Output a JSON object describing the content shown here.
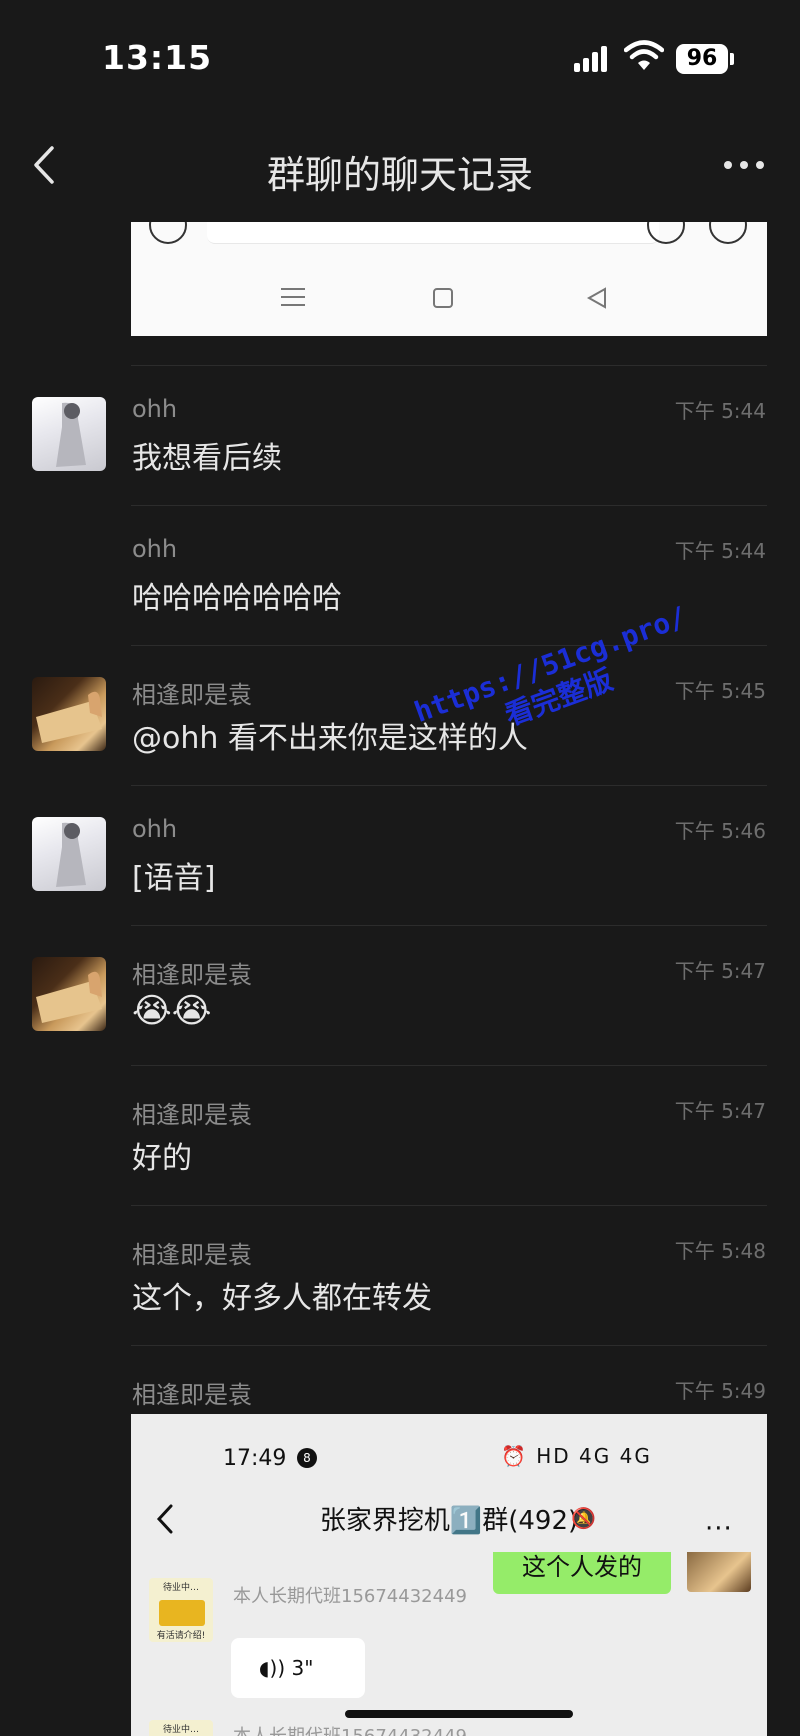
{
  "status_bar": {
    "time": "13:15",
    "battery": "96"
  },
  "navbar": {
    "title": "群聊的聊天记录"
  },
  "top_image": {},
  "messages": [
    {
      "sender": "ohh",
      "time": "下午 5:44",
      "text": "我想看后续"
    },
    {
      "sender": "ohh",
      "time": "下午 5:44",
      "text": "哈哈哈哈哈哈哈"
    },
    {
      "sender": "相逢即是袁",
      "time": "下午 5:45",
      "text": "@ohh 看不出来你是这样的人"
    },
    {
      "sender": "ohh",
      "time": "下午 5:46",
      "text": "[语音]"
    },
    {
      "sender": "相逢即是袁",
      "time": "下午 5:47",
      "text": "😭😭"
    },
    {
      "sender": "相逢即是袁",
      "time": "下午 5:47",
      "text": "好的"
    },
    {
      "sender": "相逢即是袁",
      "time": "下午 5:48",
      "text": "这个，好多人都在转发"
    },
    {
      "sender": "相逢即是袁",
      "time": "下午 5:49",
      "text": ""
    }
  ],
  "watermark": {
    "line1": "https://51cg.pro/",
    "line2": "看完整版"
  },
  "screenshot": {
    "time": "17:49",
    "badge": "8",
    "status_right": "⏰ HD 4G 4G",
    "group_title": "张家界挖机1️⃣群(492)",
    "more": "···",
    "green_bubble": "这个人发的",
    "sender1": "本人长期代班15674432449",
    "voice": "3\"",
    "sender2": "本人长期代班15674432449",
    "avatar_label_top": "待业中…",
    "avatar_label_bottom": "有活请介绍!"
  }
}
